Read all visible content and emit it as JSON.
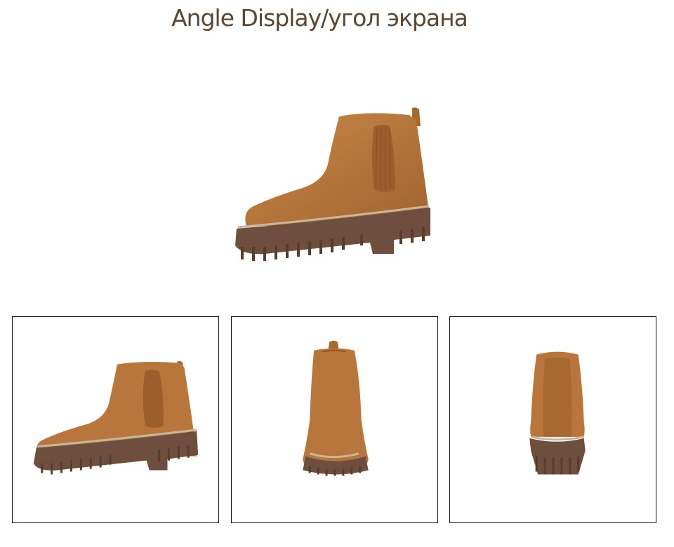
{
  "title": "Angle Display/угол экрана",
  "colors": {
    "title": "#5a4636",
    "leather": "#b8763c",
    "leather_dark": "#8f5425",
    "elastic": "#9c5e2c",
    "sole": "#6e4e3e",
    "stitch": "#c9b49c"
  },
  "views": [
    {
      "name": "side-view",
      "icon": "boot-side-image"
    },
    {
      "name": "front-view",
      "icon": "boot-front-image"
    },
    {
      "name": "back-view",
      "icon": "boot-back-image"
    }
  ]
}
